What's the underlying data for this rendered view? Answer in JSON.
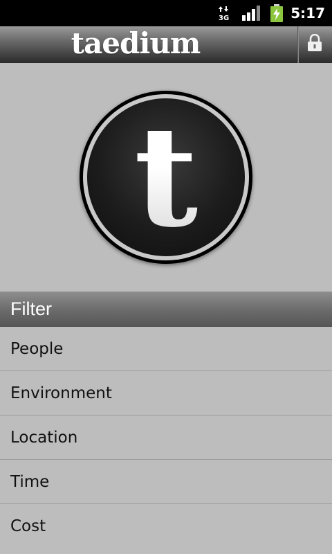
{
  "status_bar": {
    "time": "5:17",
    "network_type": "3G",
    "icons": [
      "data-3g-icon",
      "signal-strength-icon",
      "battery-charging-icon"
    ],
    "colors": {
      "background": "#000000",
      "battery": "#8cc63f",
      "text": "#ffffff"
    }
  },
  "title_bar": {
    "app_title": "taedium",
    "lock_icon": "lock-icon"
  },
  "logo": {
    "letter": "t"
  },
  "filter": {
    "header": "Filter",
    "items": [
      {
        "label": "People"
      },
      {
        "label": "Environment"
      },
      {
        "label": "Location"
      },
      {
        "label": "Time"
      },
      {
        "label": "Cost"
      }
    ]
  },
  "theme": {
    "background": "#bdbdbd",
    "list_text": "#111111",
    "divider": "#9c9c9c"
  }
}
